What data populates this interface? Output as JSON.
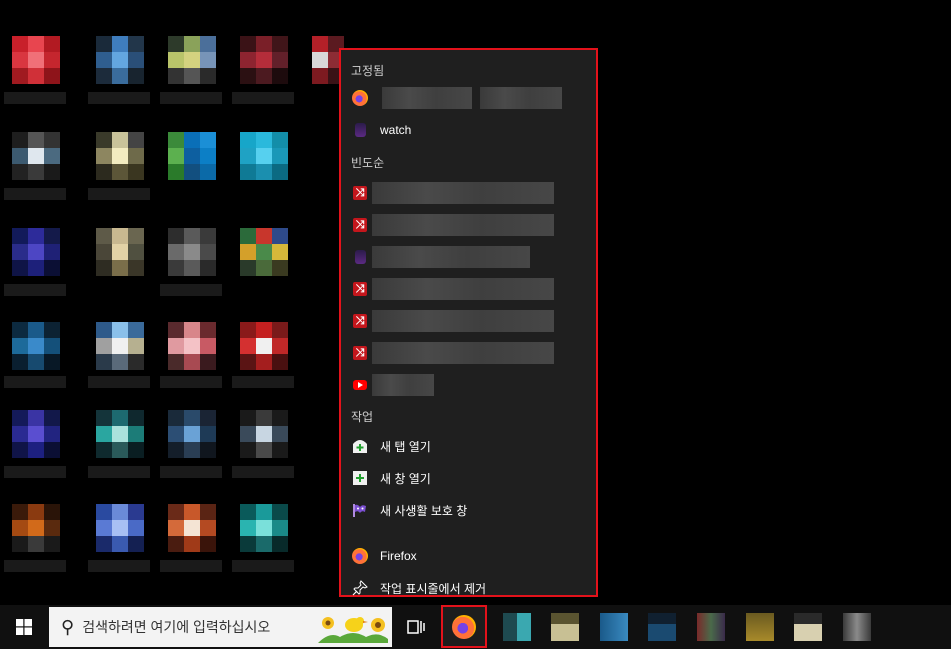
{
  "jumplist": {
    "pinned_title": "고정됨",
    "pinned": [
      {
        "icon": "firefox-icon",
        "label": ""
      },
      {
        "icon": "firefox-small-icon",
        "label": "watch"
      }
    ],
    "frequent_title": "빈도순",
    "frequent": [
      {
        "icon": "shuffle-icon",
        "label": ""
      },
      {
        "icon": "shuffle-icon",
        "label": ""
      },
      {
        "icon": "firefox-small-icon",
        "label": ""
      },
      {
        "icon": "shuffle-icon",
        "label": ""
      },
      {
        "icon": "shuffle-icon",
        "label": ""
      },
      {
        "icon": "shuffle-icon",
        "label": ""
      },
      {
        "icon": "youtube-icon",
        "label": ""
      }
    ],
    "tasks_title": "작업",
    "tasks": [
      {
        "icon": "new-tab-icon",
        "label": "새 탭 열기"
      },
      {
        "icon": "new-window-icon",
        "label": "새 창 열기"
      },
      {
        "icon": "private-window-icon",
        "label": "새 사생활 보호 창"
      }
    ],
    "app_label": "Firefox",
    "unpin_label": "작업 표시줄에서 제거"
  },
  "taskbar": {
    "search_placeholder": "검색하려면 여기에 입력하십시오"
  },
  "colors": {
    "highlight": "#e3121b",
    "jumplist_bg": "#1f1f1f",
    "taskbar_bg": "#101010"
  }
}
